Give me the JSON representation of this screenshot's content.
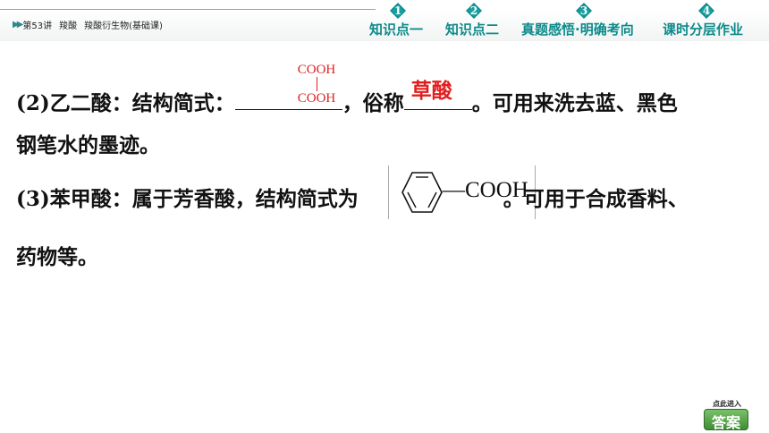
{
  "header": {
    "breadcrumb": [
      "第53讲",
      "羧酸",
      "羧酸衍生物(基础课)"
    ],
    "tabs": [
      {
        "num": "1",
        "label": "知识点一"
      },
      {
        "num": "2",
        "label": "知识点二"
      },
      {
        "num": "3",
        "label": "真题感悟·明确考向"
      },
      {
        "num": "4",
        "label": "课时分层作业"
      }
    ],
    "accent_color": "#0d8a8a"
  },
  "content": {
    "item2": {
      "prefix": "(2)乙二酸：结构简式：",
      "formula_top": "COOH",
      "formula_bottom": "COOH",
      "mid": "，俗称",
      "answer": "草酸",
      "suffix": "。可用来洗去蓝、黑色",
      "line2": "钢笔水的墨迹。"
    },
    "item3": {
      "prefix": "(3)苯甲酸：属于芳香酸，结构简式为",
      "group": "—COOH",
      "suffix": "。可用于合成香料、",
      "line2": "药物等。"
    }
  },
  "answer_button": {
    "hint": "点此进入",
    "label": "答案",
    "color": "#4a9a3e"
  }
}
